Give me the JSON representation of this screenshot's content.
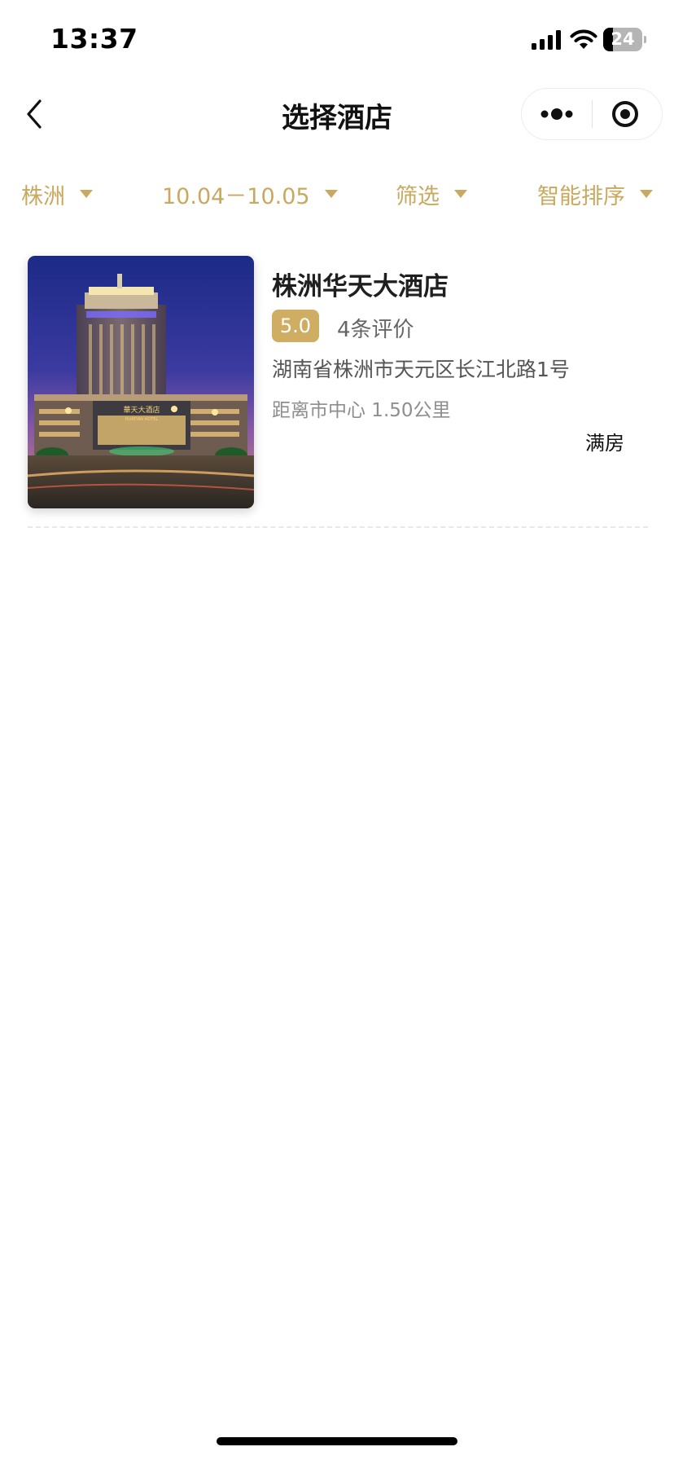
{
  "status_bar": {
    "time": "13:37",
    "battery_level": "24",
    "battery_fraction": 0.24,
    "icons": [
      "signal-icon",
      "wifi-icon",
      "battery-icon"
    ]
  },
  "nav": {
    "title": "选择酒店",
    "icons": [
      "back-chevron-icon",
      "more-dots-icon",
      "close-target-icon"
    ]
  },
  "filters": [
    {
      "label": "株洲"
    },
    {
      "label": "10.04－10.05"
    },
    {
      "label": "筛选"
    },
    {
      "label": "智能排序"
    }
  ],
  "colors": {
    "accent": "#c9a95f",
    "badge": "#cfae63"
  },
  "hotels": [
    {
      "name": "株洲华天大酒店",
      "rating": "5.0",
      "reviews": "4条评价",
      "address": "湖南省株洲市天元区长江北路1号",
      "distance": "距离市中心 1.50公里",
      "status": "满房",
      "image": {
        "sign_cn": "華天大酒店",
        "sign_en": "HUATIAN HOTEL"
      }
    }
  ]
}
